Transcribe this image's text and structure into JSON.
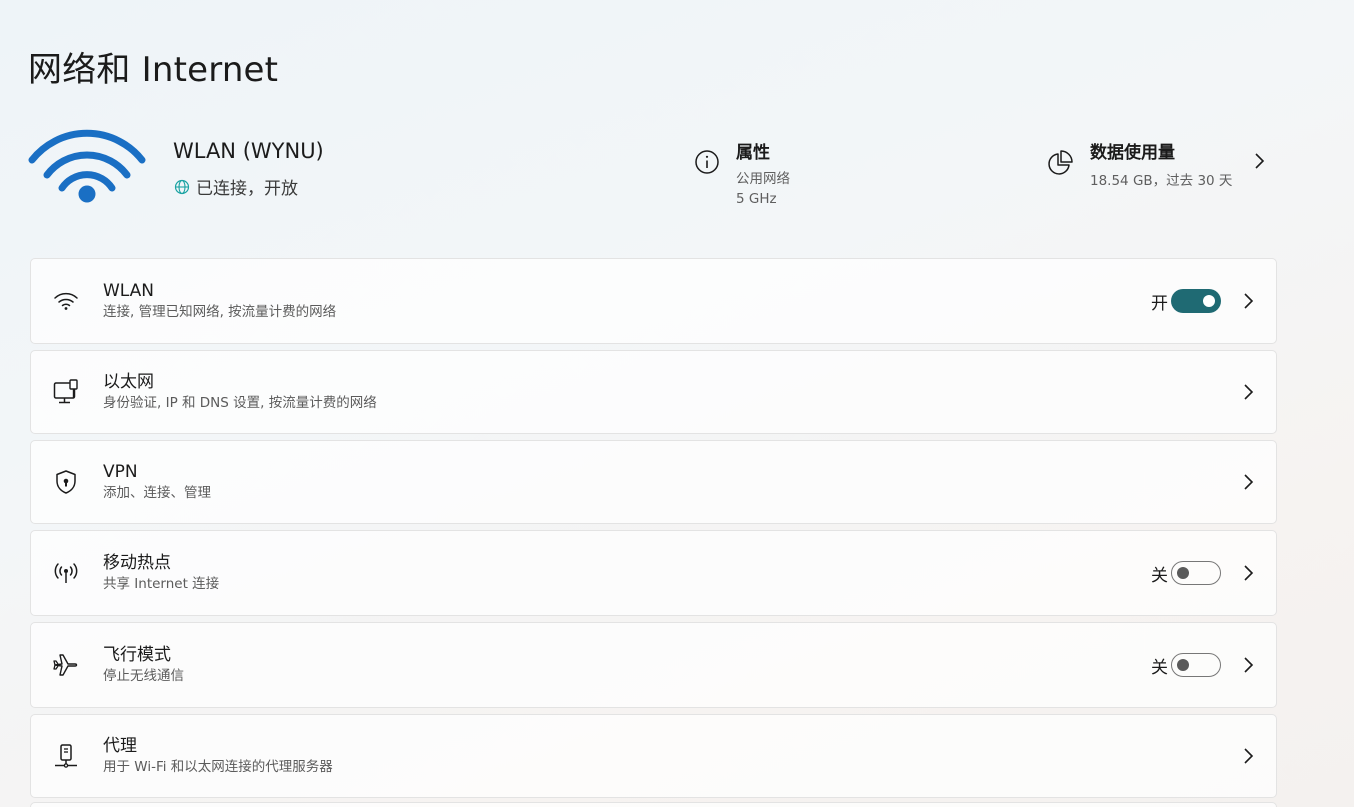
{
  "page": {
    "title": "网络和 Internet"
  },
  "connection": {
    "name": "WLAN (WYNU)",
    "status": "已连接，开放"
  },
  "properties": {
    "title": "属性",
    "network_type": "公用网络",
    "band": "5 GHz"
  },
  "data_usage": {
    "title": "数据使用量",
    "summary": "18.54 GB，过去 30 天"
  },
  "cards": [
    {
      "title": "WLAN",
      "subtitle": "连接, 管理已知网络, 按流量计费的网络",
      "state": "开",
      "toggle": "on",
      "icon": "wifi-icon"
    },
    {
      "title": "以太网",
      "subtitle": "身份验证, IP 和 DNS 设置, 按流量计费的网络",
      "icon": "ethernet-icon"
    },
    {
      "title": "VPN",
      "subtitle": "添加、连接、管理",
      "icon": "shield-icon"
    },
    {
      "title": "移动热点",
      "subtitle": "共享 Internet 连接",
      "state": "关",
      "toggle": "off",
      "icon": "hotspot-icon"
    },
    {
      "title": "飞行模式",
      "subtitle": "停止无线通信",
      "state": "关",
      "toggle": "off",
      "icon": "airplane-icon"
    },
    {
      "title": "代理",
      "subtitle": "用于 Wi-Fi 和以太网连接的代理服务器",
      "icon": "proxy-icon"
    }
  ],
  "colors": {
    "accent": "#1f6a73",
    "wifi_blue": "#1a6fc4"
  }
}
